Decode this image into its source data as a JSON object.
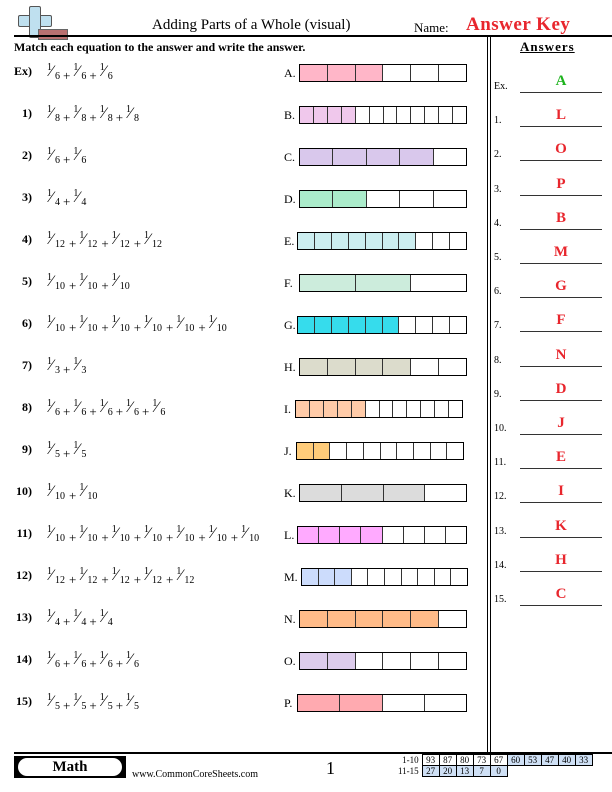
{
  "header": {
    "title": "Adding Parts of a Whole (visual)",
    "name_label": "Name:",
    "answer_key": "Answer Key",
    "instructions": "Match each equation to the answer and write the answer."
  },
  "problems": [
    {
      "num": "Ex)",
      "terms": [
        "6",
        "6",
        "6"
      ]
    },
    {
      "num": "1)",
      "terms": [
        "8",
        "8",
        "8",
        "8"
      ]
    },
    {
      "num": "2)",
      "terms": [
        "6",
        "6"
      ]
    },
    {
      "num": "3)",
      "terms": [
        "4",
        "4"
      ]
    },
    {
      "num": "4)",
      "terms": [
        "12",
        "12",
        "12",
        "12"
      ]
    },
    {
      "num": "5)",
      "terms": [
        "10",
        "10",
        "10"
      ]
    },
    {
      "num": "6)",
      "terms": [
        "10",
        "10",
        "10",
        "10",
        "10",
        "10"
      ]
    },
    {
      "num": "7)",
      "terms": [
        "3",
        "3"
      ]
    },
    {
      "num": "8)",
      "terms": [
        "6",
        "6",
        "6",
        "6",
        "6"
      ]
    },
    {
      "num": "9)",
      "terms": [
        "5",
        "5"
      ]
    },
    {
      "num": "10)",
      "terms": [
        "10",
        "10"
      ]
    },
    {
      "num": "11)",
      "terms": [
        "10",
        "10",
        "10",
        "10",
        "10",
        "10",
        "10"
      ]
    },
    {
      "num": "12)",
      "terms": [
        "12",
        "12",
        "12",
        "12",
        "12"
      ]
    },
    {
      "num": "13)",
      "terms": [
        "4",
        "4",
        "4"
      ]
    },
    {
      "num": "14)",
      "terms": [
        "6",
        "6",
        "6",
        "6"
      ]
    },
    {
      "num": "15)",
      "terms": [
        "5",
        "5",
        "5",
        "5"
      ]
    }
  ],
  "options": [
    {
      "label": "A.",
      "filled": 3,
      "total": 6,
      "color": "#ffb6c8"
    },
    {
      "label": "B.",
      "filled": 4,
      "total": 12,
      "color": "#f0c8ec"
    },
    {
      "label": "C.",
      "filled": 4,
      "total": 5,
      "color": "#d9c8ec"
    },
    {
      "label": "D.",
      "filled": 2,
      "total": 5,
      "color": "#abeccb"
    },
    {
      "label": "E.",
      "filled": 7,
      "total": 10,
      "color": "#cceef0"
    },
    {
      "label": "F.",
      "filled": 2,
      "total": 3,
      "color": "#ccecdc"
    },
    {
      "label": "G.",
      "filled": 6,
      "total": 10,
      "color": "#36dcec"
    },
    {
      "label": "H.",
      "filled": 4,
      "total": 6,
      "color": "#dcdccc"
    },
    {
      "label": "I.",
      "filled": 5,
      "total": 12,
      "color": "#ffcba8"
    },
    {
      "label": "J.",
      "filled": 2,
      "total": 10,
      "color": "#ffcc7a"
    },
    {
      "label": "K.",
      "filled": 3,
      "total": 4,
      "color": "#dcdcdc"
    },
    {
      "label": "L.",
      "filled": 4,
      "total": 8,
      "color": "#ffaaff"
    },
    {
      "label": "M.",
      "filled": 3,
      "total": 10,
      "color": "#ccdcfc"
    },
    {
      "label": "N.",
      "filled": 5,
      "total": 6,
      "color": "#ffbb88"
    },
    {
      "label": "O.",
      "filled": 2,
      "total": 6,
      "color": "#ddccec"
    },
    {
      "label": "P.",
      "filled": 2,
      "total": 4,
      "color": "#ffaab0"
    }
  ],
  "answers": {
    "title": "Answers",
    "items": [
      {
        "label": "Ex.",
        "value": "A"
      },
      {
        "label": "1.",
        "value": "L"
      },
      {
        "label": "2.",
        "value": "O"
      },
      {
        "label": "3.",
        "value": "P"
      },
      {
        "label": "4.",
        "value": "B"
      },
      {
        "label": "5.",
        "value": "M"
      },
      {
        "label": "6.",
        "value": "G"
      },
      {
        "label": "7.",
        "value": "F"
      },
      {
        "label": "8.",
        "value": "N"
      },
      {
        "label": "9.",
        "value": "D"
      },
      {
        "label": "10.",
        "value": "J"
      },
      {
        "label": "11.",
        "value": "E"
      },
      {
        "label": "12.",
        "value": "I"
      },
      {
        "label": "13.",
        "value": "K"
      },
      {
        "label": "14.",
        "value": "H"
      },
      {
        "label": "15.",
        "value": "C"
      }
    ]
  },
  "footer": {
    "badge": "Math",
    "site": "www.CommonCoreSheets.com",
    "page": "1",
    "score_rows": [
      {
        "label": "1-10",
        "cells": [
          "93",
          "87",
          "80",
          "73",
          "67",
          "60",
          "53",
          "47",
          "40",
          "33"
        ],
        "blue_from": 5
      },
      {
        "label": "11-15",
        "cells": [
          "27",
          "20",
          "13",
          "7",
          "0"
        ],
        "blue_from": 0
      }
    ]
  }
}
